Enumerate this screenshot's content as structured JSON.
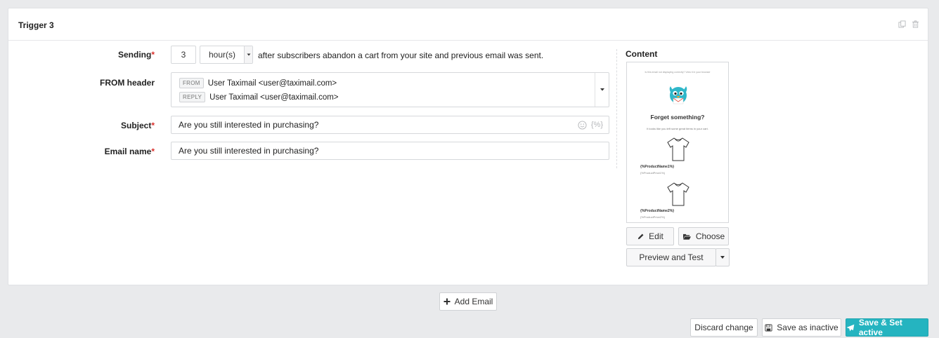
{
  "trigger": {
    "title": "Trigger 3"
  },
  "sending": {
    "label": "Sending",
    "required_mark": "*",
    "amount": "3",
    "unit": "hour(s)",
    "description": "after subscribers abandon a cart from your site and previous email was sent."
  },
  "from_header": {
    "label": "FROM header",
    "from_tag": "FROM",
    "from_value": "User Taximail <user@taximail.com>",
    "reply_tag": "REPLY",
    "reply_value": "User Taximail <user@taximail.com>"
  },
  "subject": {
    "label": "Subject",
    "required_mark": "*",
    "value": "Are you still interested in purchasing?",
    "tag_button": "{%}"
  },
  "email_name": {
    "label": "Email name",
    "required_mark": "*",
    "value": "Are you still interested in purchasing?"
  },
  "content": {
    "title": "Content",
    "preview": {
      "top_note": "Is this email not displaying correctly? View it in your browser",
      "heading": "Forget something?",
      "subtext": "It looks like you left some great items in your cart.",
      "product1_name": "{%ProductName1%}",
      "product1_price": "{%ProductPrice1%}",
      "product2_name": "{%ProductName2%}",
      "product2_price": "{%ProductPrice2%}"
    },
    "edit_label": "Edit",
    "choose_label": "Choose",
    "preview_label": "Preview and Test"
  },
  "actions": {
    "add_email": "Add Email",
    "discard": "Discard change",
    "save_inactive": "Save as inactive",
    "save_active": "Save & Set active"
  },
  "colors": {
    "accent": "#25b4c0",
    "required": "#d9302c",
    "mascot": "#2fb7c9"
  }
}
